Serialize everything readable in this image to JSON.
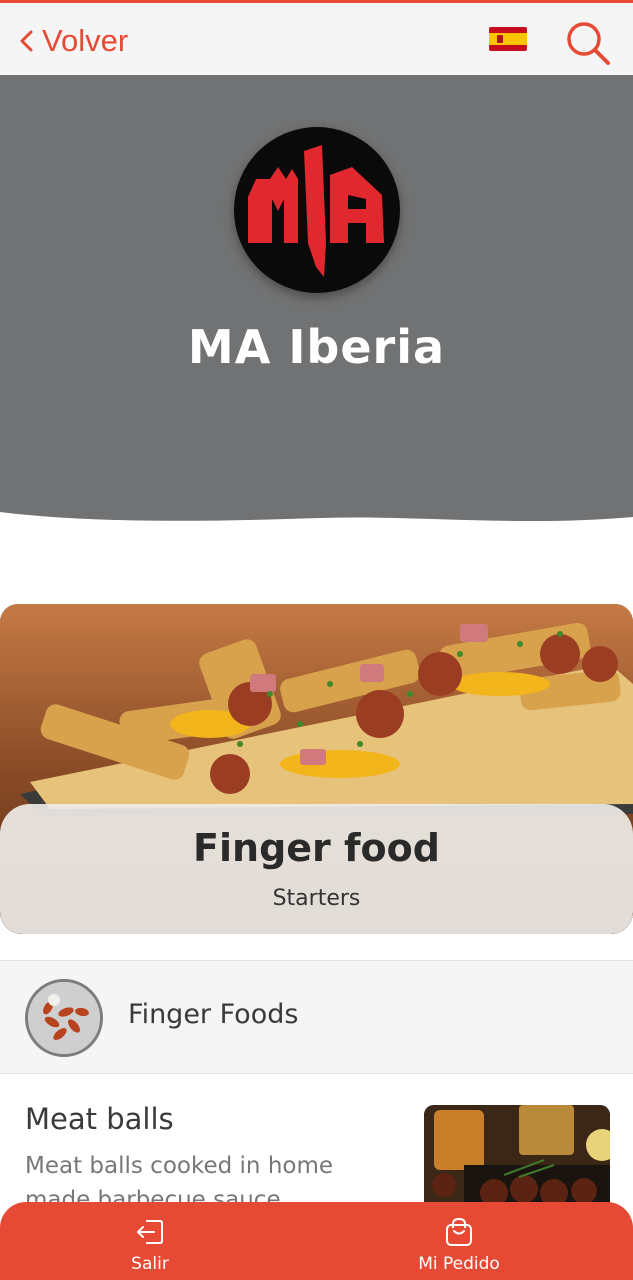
{
  "topbar": {
    "back_label": "Volver",
    "back_icon": "chevron-left-icon",
    "flag_icon": "spain-flag-icon",
    "search_icon": "search-icon"
  },
  "hero": {
    "logo_icon": "ma-iberia-logo",
    "restaurant_name": "MA Iberia"
  },
  "category_banner": {
    "title": "Finger food",
    "subtitle": "Starters"
  },
  "section": {
    "label": "Finger Foods"
  },
  "items": [
    {
      "title": "Meat balls",
      "description": "Meat balls cooked in home made barbecue sauce"
    }
  ],
  "bottom_nav": [
    {
      "label": "Salir",
      "icon": "exit-icon"
    },
    {
      "label": "Mi Pedido",
      "icon": "shopping-bag-icon"
    }
  ],
  "colors": {
    "accent": "#e64a35",
    "hero_bg": "#717273",
    "logo_red": "#e0282e"
  }
}
